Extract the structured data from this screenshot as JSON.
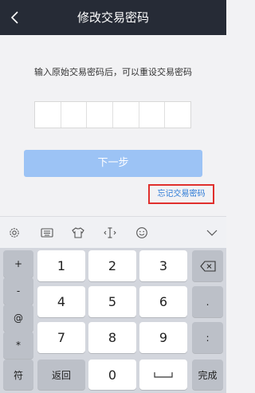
{
  "header": {
    "title": "修改交易密码",
    "back_icon": "chevron-left-icon"
  },
  "content": {
    "hint": "输入原始交易密码后，可以重设交易密码",
    "password_cells": 6,
    "next_button": "下一步",
    "forgot_link": "忘记交易密码"
  },
  "toolbar": {
    "icons": [
      "gear-icon",
      "keyboard-icon",
      "tshirt-icon",
      "text-cursor-icon",
      "emoji-icon",
      "collapse-keyboard-icon"
    ]
  },
  "keyboard": {
    "side_left": [
      "+",
      "-",
      "@",
      "*"
    ],
    "digits": [
      "1",
      "2",
      "3",
      "4",
      "5",
      "6",
      "7",
      "8",
      "9"
    ],
    "side_right": [
      "⌫",
      ".",
      ":"
    ],
    "bottom": {
      "symbols": "符",
      "back": "返回",
      "zero": "0",
      "space": "space",
      "done": "完成"
    }
  },
  "colors": {
    "header_bg": "#262b36",
    "next_button_bg": "#9cc3f5",
    "link": "#2c7ad6",
    "highlight_border": "#e0302d"
  }
}
